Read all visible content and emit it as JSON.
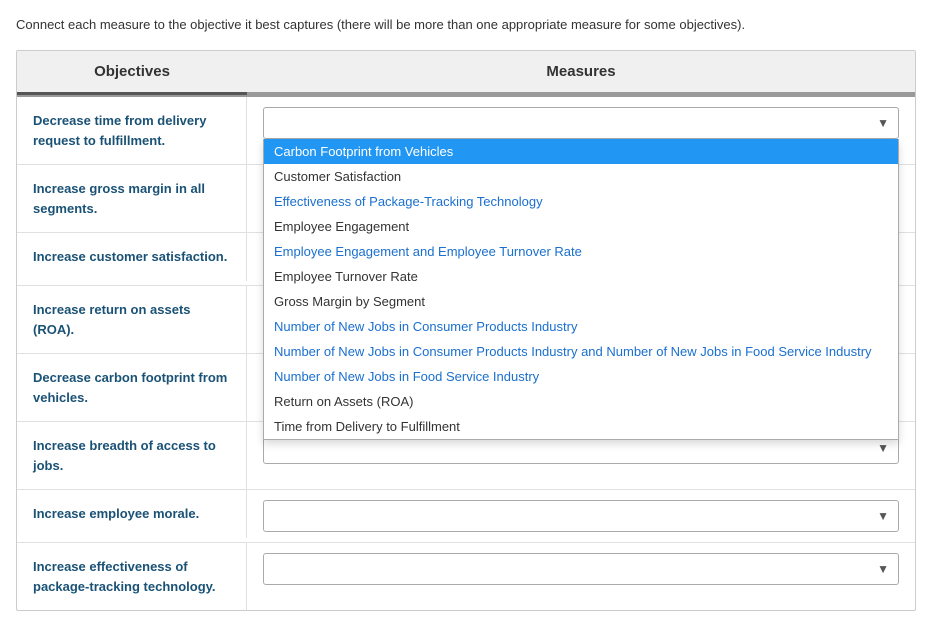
{
  "instruction": "Connect each measure to the objective it best captures (there will be more than one appropriate measure for some objectives).",
  "header": {
    "objectives_label": "Objectives",
    "measures_label": "Measures"
  },
  "rows": [
    {
      "id": "row1",
      "objective": "Decrease time from delivery request to fulfillment.",
      "selected": "",
      "dropdown_open": true
    },
    {
      "id": "row2",
      "objective": "Increase gross margin in all segments.",
      "selected": "",
      "dropdown_open": false
    },
    {
      "id": "row3",
      "objective": "Increase customer satisfaction.",
      "selected": "",
      "dropdown_open": false
    },
    {
      "id": "row4",
      "objective": "Increase return on assets (ROA).",
      "selected": "",
      "dropdown_open": false
    },
    {
      "id": "row5",
      "objective": "Decrease carbon footprint from vehicles.",
      "selected": "",
      "dropdown_open": false
    },
    {
      "id": "row6",
      "objective": "Increase breadth of access to jobs.",
      "selected": "",
      "dropdown_open": false
    },
    {
      "id": "row7",
      "objective": "Increase employee morale.",
      "selected": "",
      "dropdown_open": false
    },
    {
      "id": "row8",
      "objective": "Increase effectiveness of package-tracking technology.",
      "selected": "",
      "dropdown_open": false
    }
  ],
  "dropdown_items": [
    {
      "label": "Carbon Footprint from Vehicles",
      "style": "normal",
      "highlighted": true
    },
    {
      "label": "Customer Satisfaction",
      "style": "normal",
      "highlighted": false
    },
    {
      "label": "Effectiveness of Package-Tracking Technology",
      "style": "blue",
      "highlighted": false
    },
    {
      "label": "Employee Engagement",
      "style": "normal",
      "highlighted": false
    },
    {
      "label": "Employee Engagement and Employee Turnover Rate",
      "style": "blue",
      "highlighted": false
    },
    {
      "label": "Employee Turnover Rate",
      "style": "normal",
      "highlighted": false
    },
    {
      "label": "Gross Margin by Segment",
      "style": "normal",
      "highlighted": false
    },
    {
      "label": "Number of New Jobs in Consumer Products Industry",
      "style": "blue",
      "highlighted": false
    },
    {
      "label": "Number of New Jobs in Consumer Products Industry and Number of New Jobs in Food Service Industry",
      "style": "blue",
      "highlighted": false
    },
    {
      "label": "Number of New Jobs in Food Service Industry",
      "style": "blue",
      "highlighted": false
    },
    {
      "label": "Return on Assets (ROA)",
      "style": "normal",
      "highlighted": false
    },
    {
      "label": "Time from Delivery to Fulfillment",
      "style": "normal",
      "highlighted": false
    }
  ]
}
